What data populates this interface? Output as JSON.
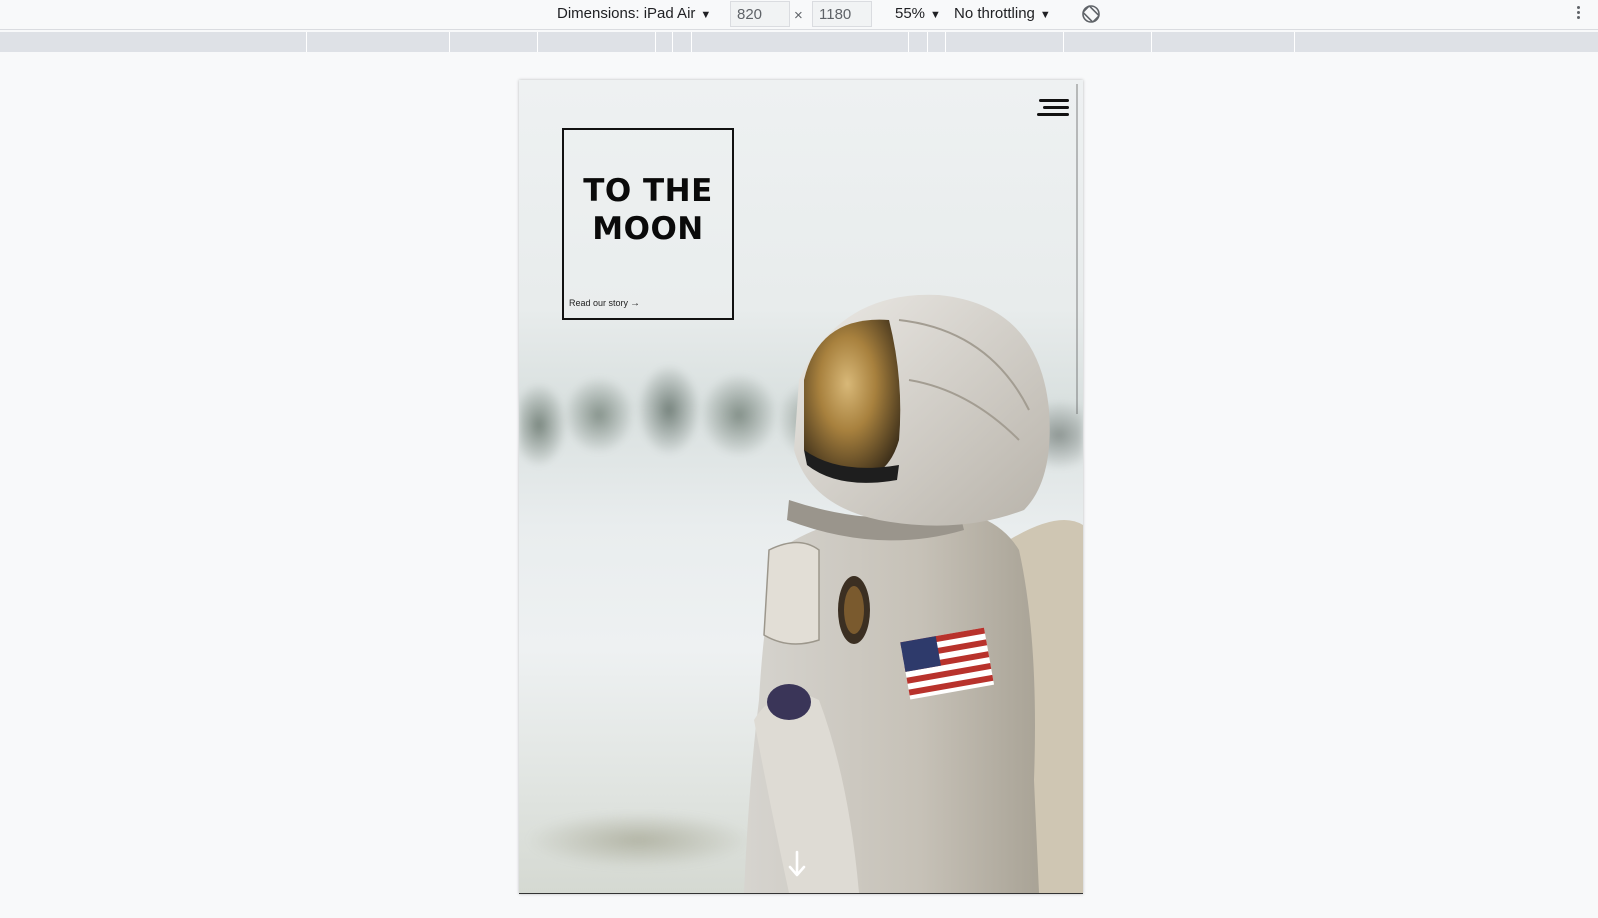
{
  "devtools": {
    "device_label": "Dimensions: iPad Air",
    "width_value": "820",
    "height_value": "1180",
    "times_symbol": "×",
    "zoom_label": "55%",
    "throttling_label": "No throttling",
    "icons": {
      "caret": "caret-down-icon",
      "rotate": "rotate-icon",
      "more": "more-vert-icon"
    }
  },
  "page": {
    "headline_line1": "TO THE",
    "headline_line2": "MOON",
    "link_text": "Read our story",
    "link_arrow": "→",
    "menu_icon": "hamburger-menu-icon",
    "scroll_icon": "arrow-down-icon"
  },
  "colors": {
    "toolbar_bg": "#f8f9fa",
    "ruler_bg": "#dee1e6",
    "headline": "#0a0a0a",
    "card_border": "#111111"
  }
}
